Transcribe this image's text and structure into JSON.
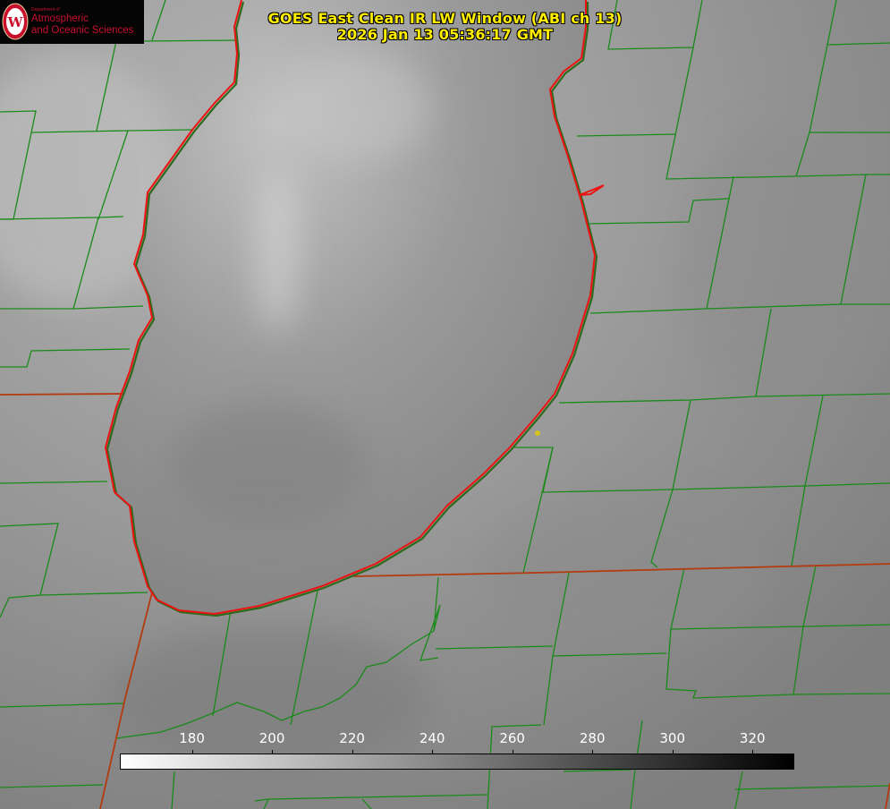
{
  "title": {
    "line1": "GOES East Clean IR LW Window (ABI ch 13)",
    "line2": "2026 Jan 13 05:36:17 GMT"
  },
  "logo": {
    "department": "Department of",
    "line1": "Atmospheric",
    "line2": "and Oceanic Sciences",
    "icon": "uw-crest-icon"
  },
  "colorbar": {
    "ticks": [
      "180",
      "200",
      "220",
      "240",
      "260",
      "280",
      "300",
      "320"
    ],
    "tick_values": [
      180,
      200,
      220,
      240,
      260,
      280,
      300,
      320
    ],
    "range": [
      162,
      330
    ],
    "gradient": "white-to-black"
  },
  "map": {
    "feature": "lake-outline",
    "colors": {
      "lake_outline": "#ee1111",
      "county_lines": "#1a8a1a",
      "state_lines": "#b43a10",
      "marker": "#d6c21a"
    }
  }
}
